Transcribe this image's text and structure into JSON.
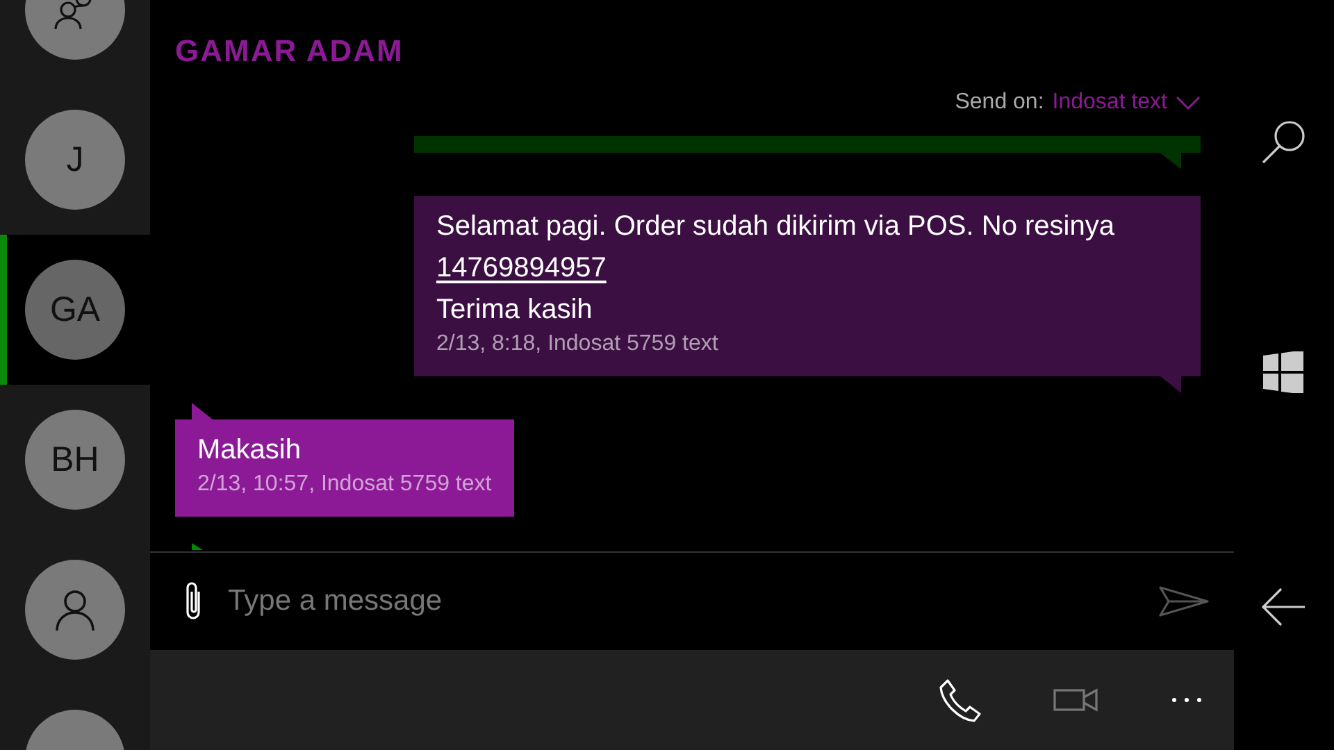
{
  "contacts": [
    {
      "kind": "group",
      "selected": false
    },
    {
      "kind": "initials",
      "initials": "J",
      "selected": false
    },
    {
      "kind": "initials",
      "initials": "GA",
      "selected": true
    },
    {
      "kind": "initials",
      "initials": "BH",
      "selected": false
    },
    {
      "kind": "person",
      "selected": false
    },
    {
      "kind": "cut",
      "selected": false
    }
  ],
  "conversation": {
    "title": "GAMAR ADAM",
    "send_on_label": "Send on:",
    "send_on_value": "Indosat text",
    "messages": [
      {
        "kind": "sent",
        "color": "#003300"
      },
      {
        "kind": "sent",
        "color": "#3b0f42",
        "lines": [
          {
            "kind": "text",
            "text": "Selamat pagi. Order sudah dikirim via POS. No resinya"
          },
          {
            "kind": "link",
            "text": "14769894957"
          },
          {
            "kind": "text",
            "text": "Terima kasih"
          }
        ],
        "meta": "2/13, 8:18, Indosat 5759 text"
      },
      {
        "kind": "received",
        "color": "#8c1a96",
        "lines": [
          {
            "kind": "text",
            "text": "Makasih"
          }
        ],
        "meta": "2/13, 10:57, Indosat 5759 text"
      },
      {
        "kind": "received",
        "color": "#008800"
      }
    ],
    "composer": {
      "placeholder": "Type a message"
    }
  }
}
